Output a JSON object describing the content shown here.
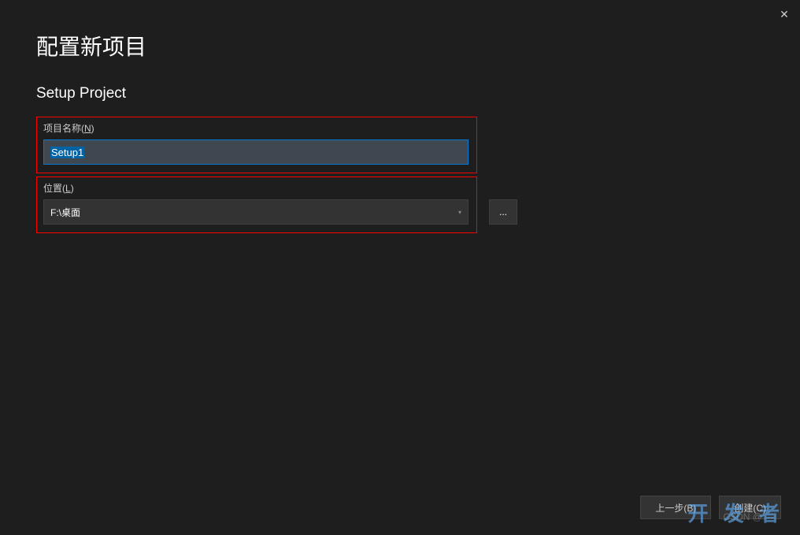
{
  "window": {
    "close_icon": "✕"
  },
  "header": {
    "main_title": "配置新项目",
    "sub_title": "Setup Project"
  },
  "form": {
    "project_name": {
      "label_prefix": "项目名称(",
      "label_hotkey": "N",
      "label_suffix": ")",
      "value": "Setup1"
    },
    "location": {
      "label_prefix": "位置(",
      "label_hotkey": "L",
      "label_suffix": ")",
      "value": "F:\\桌面",
      "browse_label": "..."
    }
  },
  "footer": {
    "back_label": "上一步(B)",
    "create_label": "创建(C)"
  },
  "watermark": {
    "text1": "CSDN @",
    "text2": "开 发 者"
  }
}
